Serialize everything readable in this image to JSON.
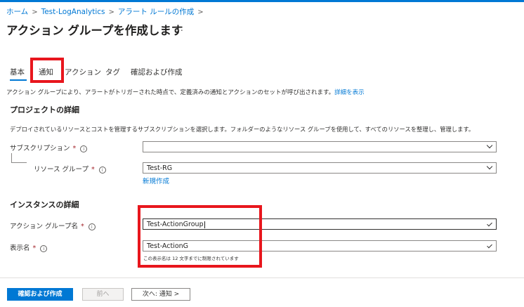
{
  "breadcrumb": [
    "ホーム",
    "Test-LogAnalytics",
    "アラート ルールの作成"
  ],
  "breadcrumb_separator": ">",
  "page_title": "アクション グループを作成します",
  "more_icon": "…",
  "tabs": [
    "基本",
    "通知",
    "アクション",
    "タグ",
    "確認および作成"
  ],
  "active_tab": "基本",
  "highlighted_tab": "通知",
  "intro": {
    "text": "アクション グループにより、アラートがトリガーされた時点で、定義済みの通知とアクションのセットが呼び出されます。",
    "link": "詳細を表示"
  },
  "project": {
    "heading": "プロジェクトの詳細",
    "description": "デプロイされているリソースとコストを管理するサブスクリプションを選択します。フォルダーのようなリソース グループを使用して、すべてのリソースを整理し、管理します。",
    "subscription_label": "サブスクリプション",
    "subscription_value": "",
    "resource_group_label": "リソース グループ",
    "resource_group_value": "Test-RG",
    "create_new_link": "新規作成"
  },
  "instance": {
    "heading": "インスタンスの詳細",
    "action_group_name_label": "アクション グループ名",
    "action_group_name_value": "Test-ActionGroup",
    "display_name_label": "表示名",
    "display_name_value": "Test-ActionG",
    "display_name_hint": "この表示名は 12 文字までに制限されています"
  },
  "required_mark": "*",
  "info_glyph": "i",
  "footer": {
    "review_create": "確認および作成",
    "previous": "前へ",
    "next": "次へ: 通知 >"
  },
  "colors": {
    "accent": "#0078d4",
    "highlight": "#e8161d",
    "required": "#a4262c"
  }
}
